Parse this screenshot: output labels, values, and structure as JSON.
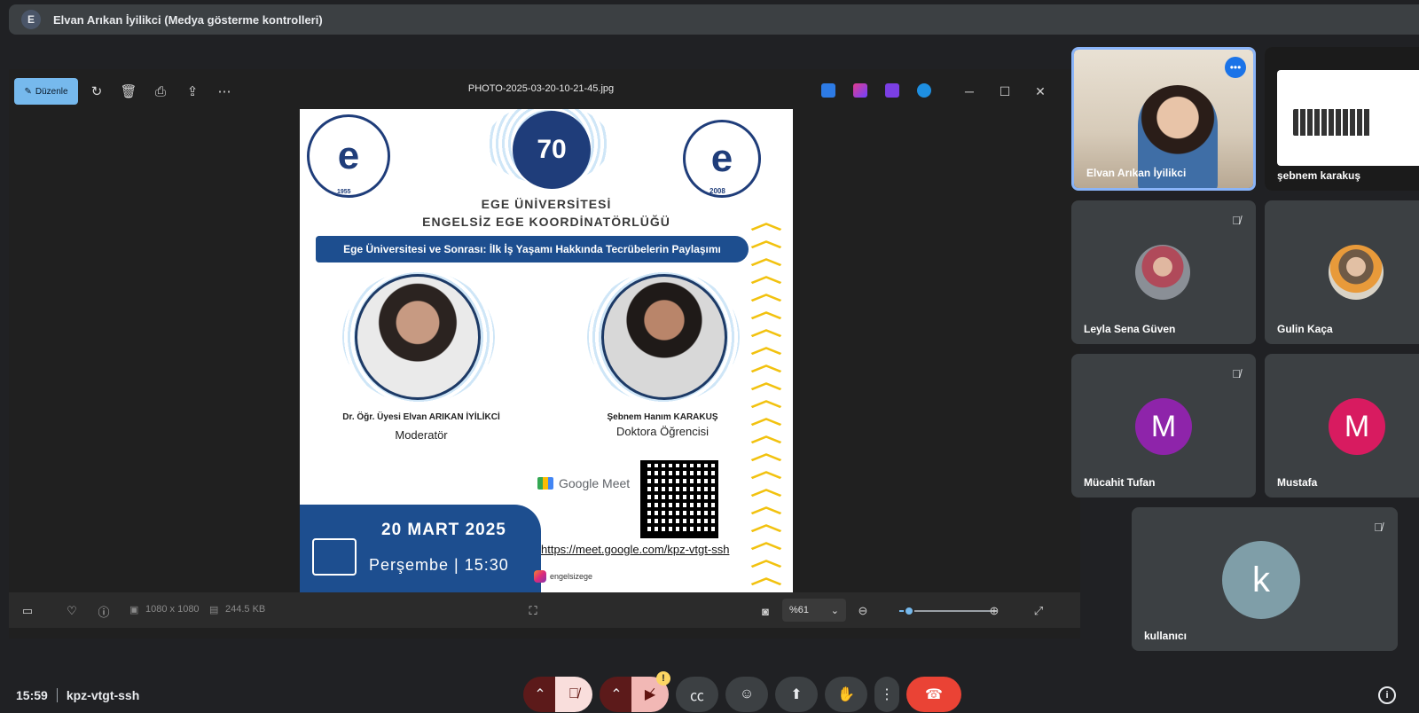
{
  "presenter_bar": {
    "avatar_letter": "E",
    "title": "Elvan Arıkan İyilikci (Medya gösterme kontrolleri)"
  },
  "viewer": {
    "edit_label": "Düzenle",
    "filename": "PHOTO-2025-03-20-10-21-45.jpg",
    "dimensions": "1080 x 1080",
    "file_size": "244.5 KB",
    "zoom_value": "%61",
    "zoom_fraction": 0.1
  },
  "poster": {
    "logo_70_text": "70",
    "university": "EGE ÜNİVERSİTESİ",
    "coordination": "ENGELSİZ EGE KOORDİNATÖRLÜĞÜ",
    "banner": "Ege Üniversitesi ve Sonrası: İlk İş Yaşamı Hakkında Tecrübelerin Paylaşımı",
    "speaker1_name": "Dr. Öğr. Üyesi Elvan ARIKAN İYİLİKCİ",
    "speaker1_role": "Moderatör",
    "speaker2_name": "Şebnem Hanım KARAKUŞ",
    "speaker2_role": "Doktora Öğrencisi",
    "date": "20 MART 2025",
    "day_time": "Perşembe | 15:30",
    "meet_brand": "Google Meet",
    "meet_link": "https://meet.google.com/kpz-vtgt-ssh",
    "instagram": "engelsizege",
    "logo_year_left": "1955",
    "logo_year_right": "2008"
  },
  "participants": [
    {
      "name": "Elvan Arıkan İyilikci",
      "type": "video"
    },
    {
      "name": "şebnem karakuş",
      "type": "screen"
    },
    {
      "name": "Leyla Sena Güven",
      "type": "photo"
    },
    {
      "name": "Gulin Kaça",
      "type": "photo"
    },
    {
      "name": "Mücahit Tufan",
      "letter": "M",
      "color": "#8e24aa"
    },
    {
      "name": "Mustafa",
      "letter": "M",
      "color": "#d81b60"
    },
    {
      "name": "kullanıcı",
      "letter": "k",
      "color": "#7f9ea8"
    }
  ],
  "meeting": {
    "time": "15:59",
    "code": "kpz-vtgt-ssh",
    "warning_badge": "!"
  },
  "icons": {
    "edit": "pencil-icon",
    "rotate": "rotate-icon",
    "delete": "trash-icon",
    "print": "print-icon",
    "share": "share-icon",
    "mic_off": "mic-off-icon",
    "cam_off": "camera-off-icon",
    "captions": "captions-icon",
    "emoji": "emoji-icon",
    "present": "present-icon",
    "hand": "raise-hand-icon",
    "more": "more-vert-icon",
    "hangup": "call-end-icon",
    "info": "info-icon"
  }
}
